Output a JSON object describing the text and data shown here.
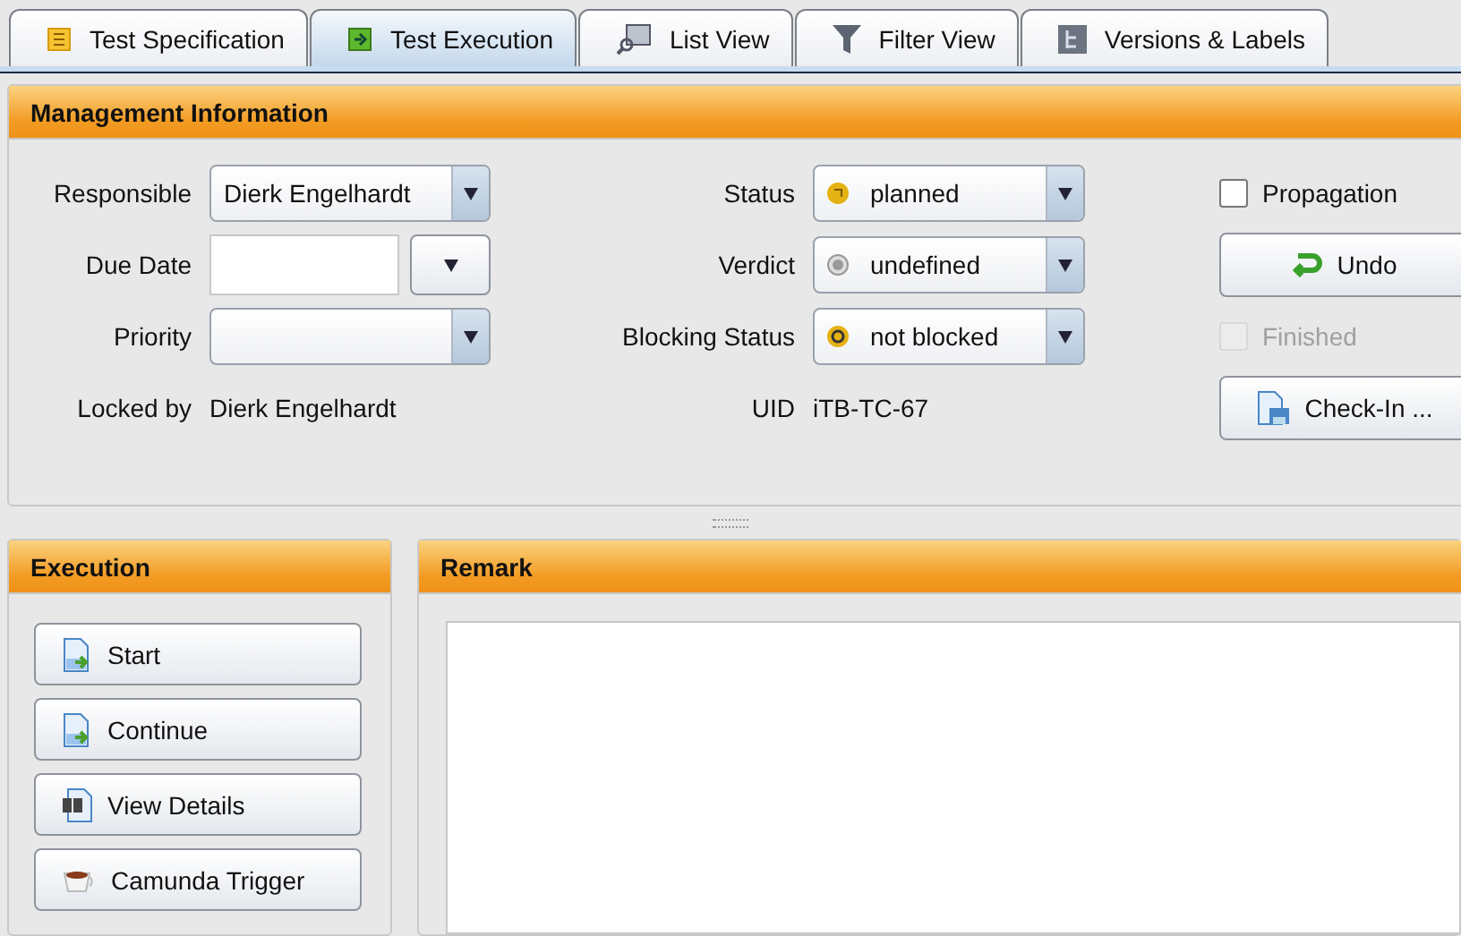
{
  "tabs": [
    {
      "label": "Test Specification",
      "selected": false
    },
    {
      "label": "Test Execution",
      "selected": true
    },
    {
      "label": "List View",
      "selected": false
    },
    {
      "label": "Filter View",
      "selected": false
    },
    {
      "label": "Versions & Labels",
      "selected": false
    }
  ],
  "management": {
    "title": "Management Information",
    "left_fields": [
      {
        "label": "Responsible",
        "kind": "combo",
        "value": "Dierk Engelhardt"
      },
      {
        "label": "Due Date",
        "kind": "date"
      },
      {
        "label": "Priority",
        "kind": "combo"
      }
    ],
    "locked_by": {
      "label": "Locked by",
      "value": "Dierk Engelhardt"
    },
    "mid_fields": [
      {
        "label": "Status",
        "value": "planned"
      },
      {
        "label": "Verdict",
        "value": "undefined"
      },
      {
        "label": "Blocking Status",
        "value": "not blocked"
      }
    ],
    "uid": {
      "label": "UID",
      "value": "iTB-TC-67"
    },
    "propagation": {
      "label": "Propagation",
      "checked": false,
      "disabled": false
    },
    "undo_button": "Undo",
    "finished": {
      "label": "Finished",
      "checked": false,
      "disabled": true
    },
    "checkin_button": "Check-In ..."
  },
  "execution": {
    "title": "Execution",
    "buttons": [
      "Start",
      "Continue",
      "View Details",
      "Camunda Trigger"
    ]
  },
  "remark": {
    "title": "Remark"
  }
}
